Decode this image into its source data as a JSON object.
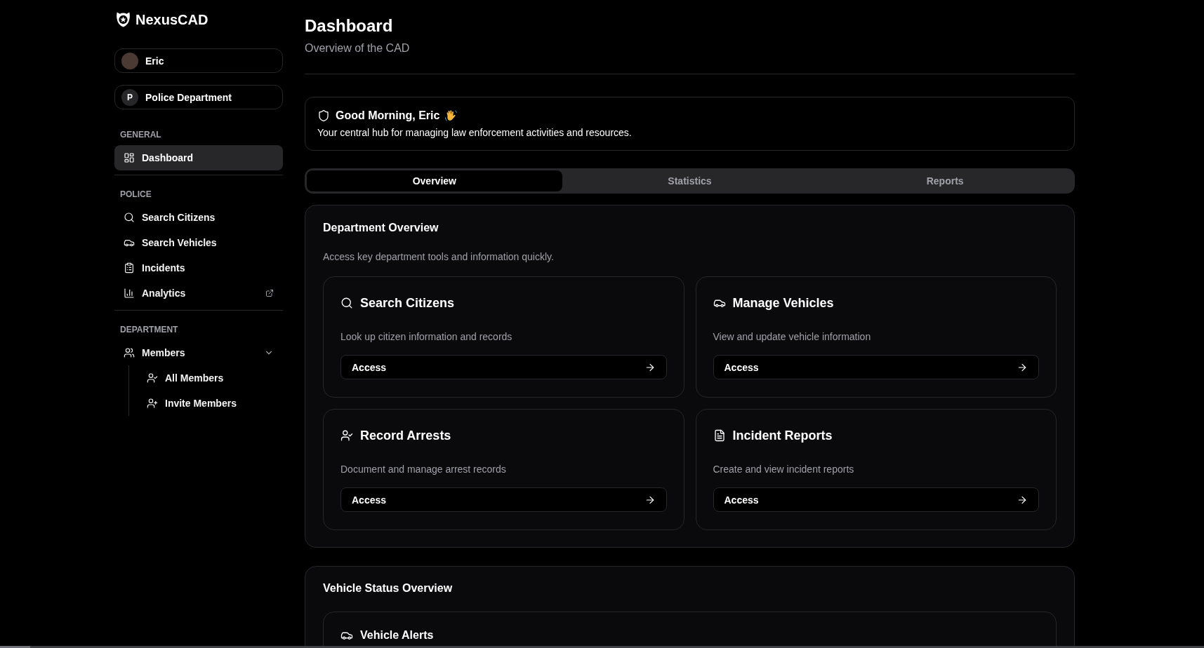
{
  "brand": {
    "name": "NexusCAD"
  },
  "account": {
    "user": "Eric",
    "department_initial": "P",
    "department": "Police Department"
  },
  "nav_sections": [
    {
      "title": "GENERAL",
      "items": [
        {
          "label": "Dashboard",
          "selected": true
        }
      ]
    },
    {
      "title": "POLICE",
      "items": [
        {
          "label": "Search Citizens",
          "selected": false
        },
        {
          "label": "Search Vehicles",
          "selected": false
        },
        {
          "label": "Incidents",
          "selected": false
        },
        {
          "label": "Analytics",
          "selected": false,
          "external": true
        }
      ]
    },
    {
      "title": "DEPARTMENT",
      "items": [
        {
          "label": "Members",
          "selected": false,
          "expanded": true,
          "children": [
            {
              "label": "All Members",
              "selected": false
            },
            {
              "label": "Invite Members",
              "selected": false
            }
          ]
        }
      ]
    }
  ],
  "header": {
    "title": "Dashboard",
    "subtitle": "Overview of the CAD"
  },
  "greeting": {
    "title": "Good Morning, Eric",
    "text": "Your central hub for managing law enforcement activities and resources."
  },
  "tabs": [
    {
      "label": "Overview",
      "selected": true
    },
    {
      "label": "Statistics",
      "selected": false
    },
    {
      "label": "Reports",
      "selected": false
    }
  ],
  "department_overview": {
    "title": "Department Overview",
    "description": "Access key department tools and information quickly.",
    "cards": [
      {
        "title": "Search Citizens",
        "description": "Look up citizen information and records",
        "button": "Access"
      },
      {
        "title": "Manage Vehicles",
        "description": "View and update vehicle information",
        "button": "Access"
      },
      {
        "title": "Record Arrests",
        "description": "Document and manage arrest records",
        "button": "Access"
      },
      {
        "title": "Incident Reports",
        "description": "Create and view incident reports",
        "button": "Access"
      }
    ]
  },
  "vehicle_status": {
    "title": "Vehicle Status Overview",
    "cards": [
      {
        "title": "Vehicle Alerts"
      }
    ]
  }
}
